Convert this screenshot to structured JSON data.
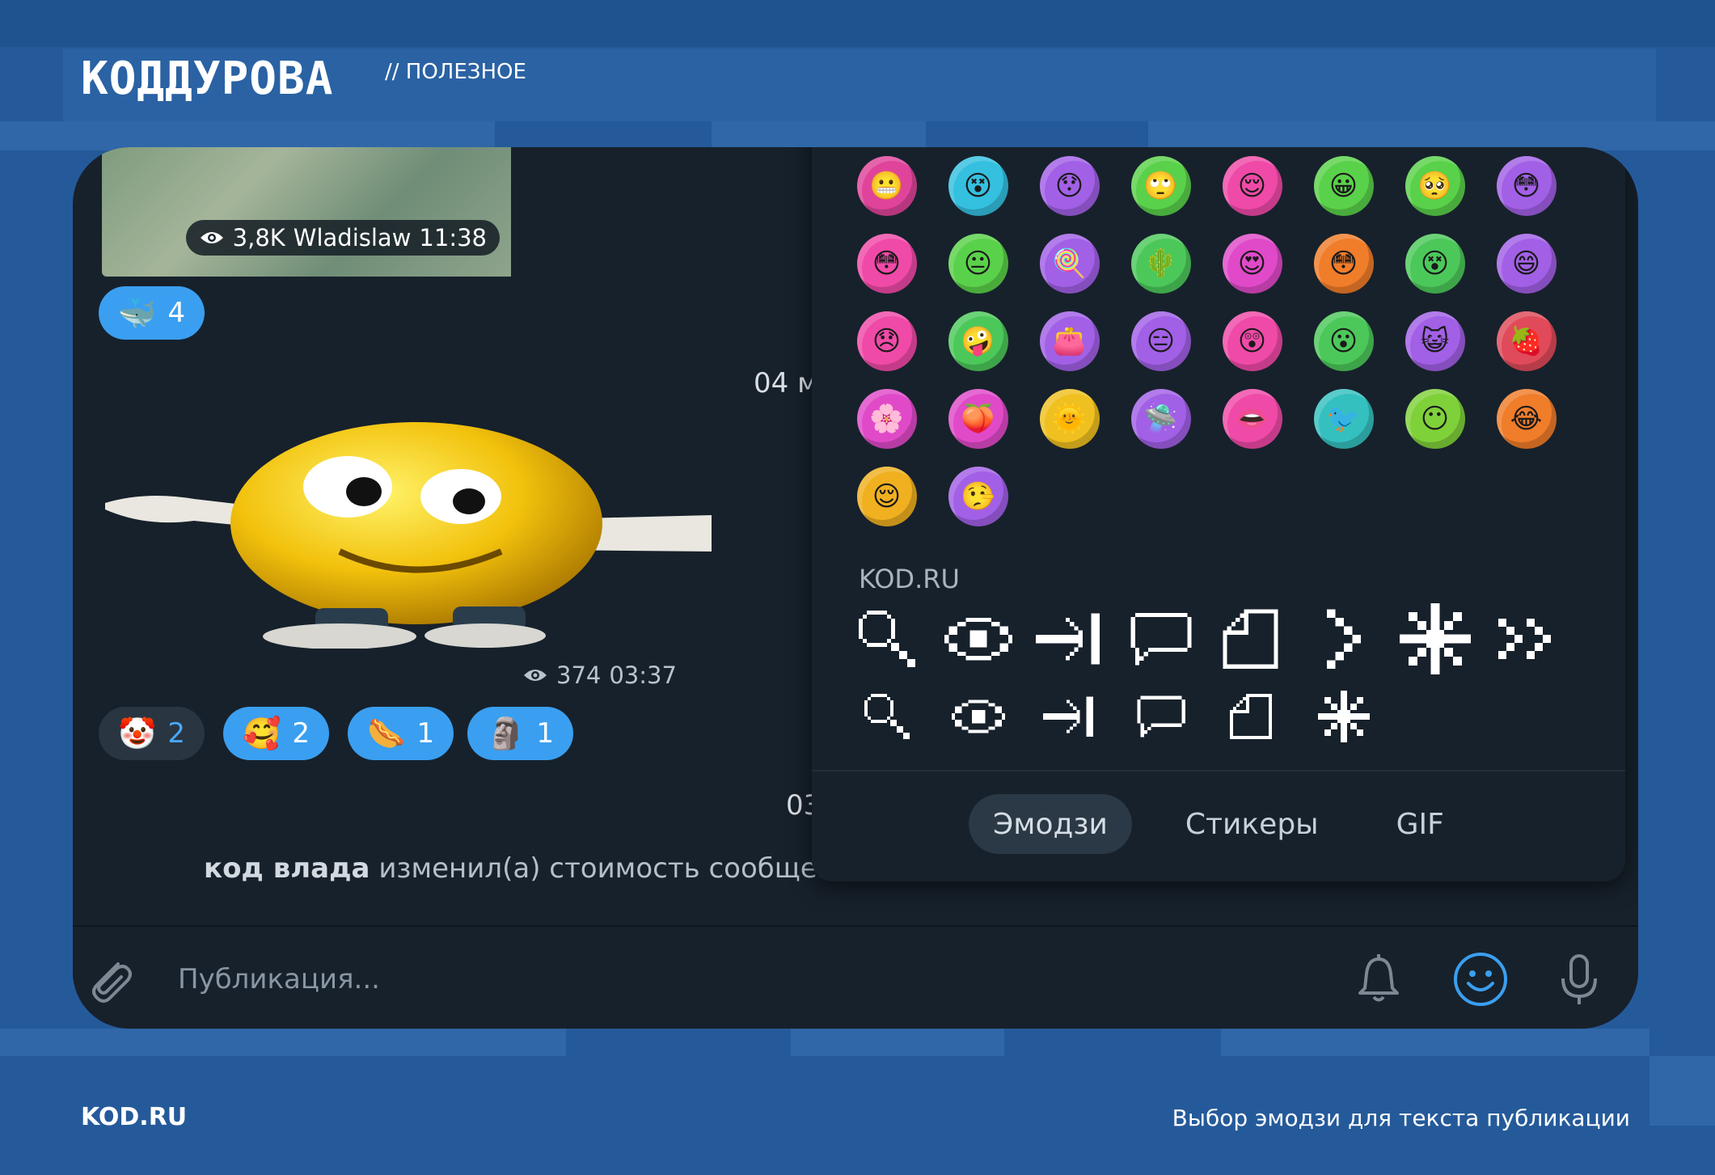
{
  "brand": {
    "logo_text": "КОДДУРОВА",
    "section": "// ПОЛЕЗНОЕ"
  },
  "footer": {
    "site": "KOD.RU",
    "caption": "Выбор эмодзи для текста публикации"
  },
  "chat": {
    "photo_meta": {
      "views": "3,8K",
      "author": "Wladislaw",
      "time": "11:38"
    },
    "photo_reaction": {
      "emoji": "🐳",
      "count": "4"
    },
    "date_1": "04 м",
    "sticker_meta": {
      "views": "374",
      "time": "03:37"
    },
    "sticker_reactions": [
      {
        "emoji": "🤡",
        "count": "2",
        "active": false
      },
      {
        "emoji": "🥰",
        "count": "2",
        "active": true
      },
      {
        "emoji": "🌭",
        "count": "1",
        "active": true
      },
      {
        "emoji": "🗿",
        "count": "1",
        "active": true
      }
    ],
    "date_2": "03",
    "service_message": {
      "actor": "код влада",
      "text": "изменил(а) стоимость сообщен"
    }
  },
  "composer": {
    "placeholder": "Публикация..."
  },
  "emoji_panel": {
    "emojis": [
      {
        "color": "#e0449a",
        "face": "😬"
      },
      {
        "color": "#35c0e0",
        "face": "😵"
      },
      {
        "color": "#a260e6",
        "face": "😯"
      },
      {
        "color": "#5ad14a",
        "face": "🙄"
      },
      {
        "color": "#ef4aa8",
        "face": "😌"
      },
      {
        "color": "#5ad14a",
        "face": "😀"
      },
      {
        "color": "#5ad14a",
        "face": "🥺"
      },
      {
        "color": "#a260e6",
        "face": "😳"
      },
      {
        "color": "#f04aa8",
        "face": "😳"
      },
      {
        "color": "#5ad14a",
        "face": "😐"
      },
      {
        "color": "#a260e6",
        "face": "🍭"
      },
      {
        "color": "#4cc85a",
        "face": "🌵"
      },
      {
        "color": "#e04ac8",
        "face": "😍"
      },
      {
        "color": "#f07d2a",
        "face": "😳"
      },
      {
        "color": "#4cc85a",
        "face": "😵"
      },
      {
        "color": "#a260e6",
        "face": "😄"
      },
      {
        "color": "#f04aa8",
        "face": "😞"
      },
      {
        "color": "#4cc85a",
        "face": "🤪"
      },
      {
        "color": "#a260e6",
        "face": "👛"
      },
      {
        "color": "#a260e6",
        "face": "😑"
      },
      {
        "color": "#f04aa8",
        "face": "😲"
      },
      {
        "color": "#4cc85a",
        "face": "😮"
      },
      {
        "color": "#a260e6",
        "face": "😺"
      },
      {
        "color": "#e04a5a",
        "face": "🍓"
      },
      {
        "color": "#e04ac8",
        "face": "🌸"
      },
      {
        "color": "#e04ac8",
        "face": "🍑"
      },
      {
        "color": "#f0c020",
        "face": "🌞"
      },
      {
        "color": "#a260e6",
        "face": "🛸"
      },
      {
        "color": "#f04aa8",
        "face": "👄"
      },
      {
        "color": "#35c0c0",
        "face": "🐦"
      },
      {
        "color": "#7fd13a",
        "face": "😶"
      },
      {
        "color": "#f07d2a",
        "face": "😂"
      },
      {
        "color": "#f0b020",
        "face": "😌"
      },
      {
        "color": "#a260e6",
        "face": "🤥"
      }
    ],
    "section_title": "KOD.RU",
    "pixel_icons_row1": [
      "search-icon",
      "eye-icon",
      "arrow-right-bar-icon",
      "speech-bubble-icon",
      "document-icon",
      "chevron-right-icon",
      "asterisk-icon",
      "double-chevron-icon"
    ],
    "pixel_icons_row2": [
      "search-icon",
      "eye-icon",
      "arrow-right-bar-icon",
      "speech-bubble-icon",
      "document-icon",
      "asterisk-icon"
    ],
    "tabs": [
      {
        "label": "Эмодзи",
        "active": true
      },
      {
        "label": "Стикеры",
        "active": false
      },
      {
        "label": "GIF",
        "active": false
      }
    ]
  }
}
